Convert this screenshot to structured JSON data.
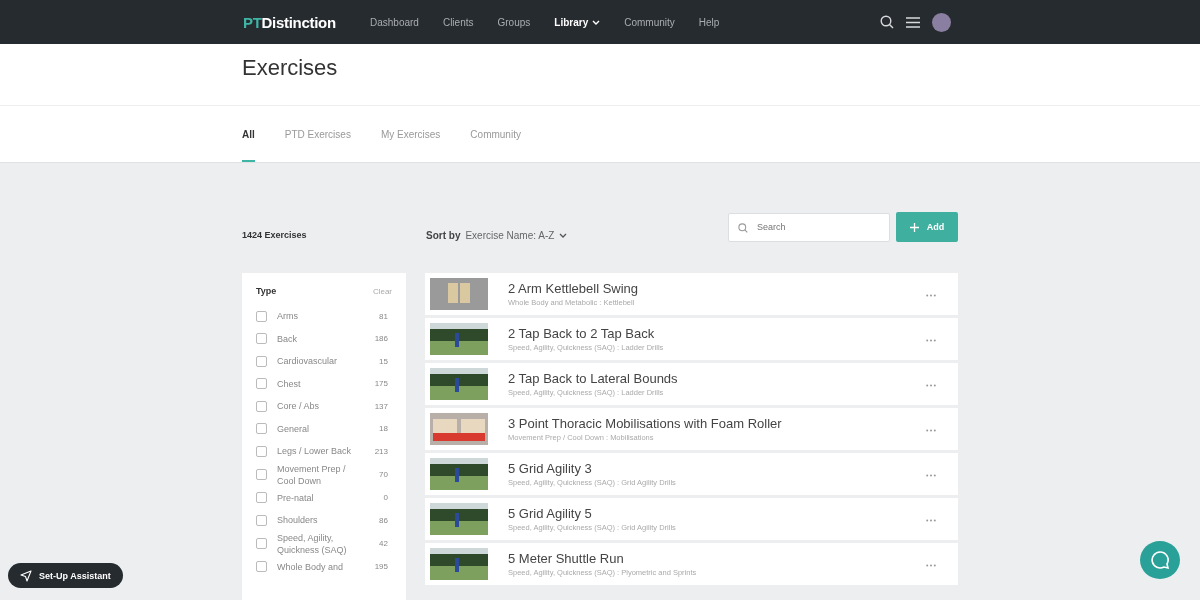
{
  "nav": {
    "logo_accent": "PT",
    "logo_rest": "Distinction",
    "items": [
      {
        "label": "Dashboard",
        "selected": false,
        "dropdown": false
      },
      {
        "label": "Clients",
        "selected": false,
        "dropdown": false
      },
      {
        "label": "Groups",
        "selected": false,
        "dropdown": false
      },
      {
        "label": "Library",
        "selected": true,
        "dropdown": true
      },
      {
        "label": "Community",
        "selected": false,
        "dropdown": false
      },
      {
        "label": "Help",
        "selected": false,
        "dropdown": false
      }
    ]
  },
  "page_title": "Exercises",
  "tabs": [
    {
      "label": "All",
      "selected": true
    },
    {
      "label": "PTD Exercises",
      "selected": false
    },
    {
      "label": "My Exercises",
      "selected": false
    },
    {
      "label": "Community",
      "selected": false
    }
  ],
  "toolbar": {
    "count": "1424 Exercises",
    "sort_label": "Sort by",
    "sort_value": "Exercise Name: A-Z",
    "search": {
      "placeholder": "Search"
    },
    "add_button": "Add"
  },
  "filter": {
    "title": "Type",
    "clear": "Clear",
    "items": [
      {
        "label": "Arms",
        "count": "81",
        "checked": false
      },
      {
        "label": "Back",
        "count": "186",
        "checked": false
      },
      {
        "label": "Cardiovascular",
        "count": "15",
        "checked": false
      },
      {
        "label": "Chest",
        "count": "175",
        "checked": false
      },
      {
        "label": "Core / Abs",
        "count": "137",
        "checked": false
      },
      {
        "label": "General",
        "count": "18",
        "checked": false
      },
      {
        "label": "Legs / Lower Back",
        "count": "213",
        "checked": false
      },
      {
        "label": "Movement Prep / Cool Down",
        "count": "70",
        "checked": false
      },
      {
        "label": "Pre-natal",
        "count": "0",
        "checked": false
      },
      {
        "label": "Shoulders",
        "count": "86",
        "checked": false
      },
      {
        "label": "Speed, Agility, Quickness (SAQ)",
        "count": "42",
        "checked": false
      },
      {
        "label": "Whole Body and",
        "count": "195",
        "checked": false
      }
    ]
  },
  "exercises": [
    {
      "name": "2 Arm Kettlebell Swing",
      "category": "Whole Body and Metabolic : Kettlebell",
      "kind": "studio"
    },
    {
      "name": "2 Tap Back to 2 Tap Back",
      "category": "Speed, Agility, Quickness (SAQ) : Ladder Drills",
      "kind": "field"
    },
    {
      "name": "2 Tap Back to Lateral Bounds",
      "category": "Speed, Agility, Quickness (SAQ) : Ladder Drills",
      "kind": "field"
    },
    {
      "name": "3 Point Thoracic Mobilisations with Foam Roller",
      "category": "Movement Prep / Cool Down : Mobilisations",
      "kind": "mat"
    },
    {
      "name": "5 Grid Agility 3",
      "category": "Speed, Agility, Quickness (SAQ) : Grid Agility Drills",
      "kind": "field"
    },
    {
      "name": "5 Grid Agility 5",
      "category": "Speed, Agility, Quickness (SAQ) : Grid Agility Drills",
      "kind": "field"
    },
    {
      "name": "5 Meter Shuttle Run",
      "category": "Speed, Agility, Quickness (SAQ) : Plyometric and Sprints",
      "kind": "field"
    }
  ],
  "assistant_button": "Set-Up Assistant"
}
